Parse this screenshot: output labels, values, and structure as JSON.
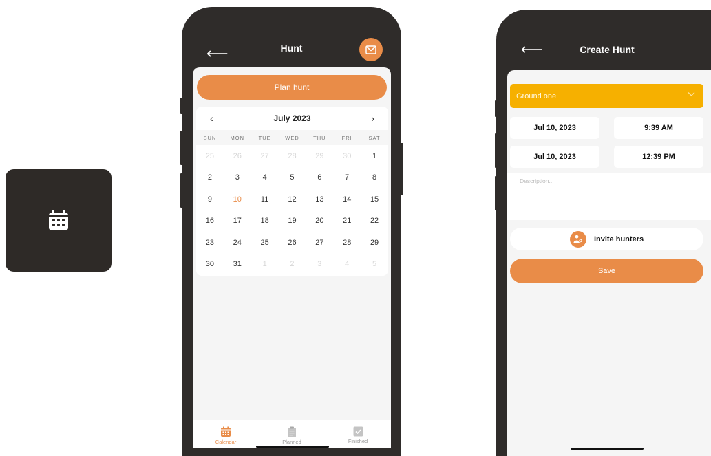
{
  "colors": {
    "accent": "#e98c48",
    "ground": "#f6b000",
    "frame": "#2f2c2a",
    "icon_bg": "#2e2a27"
  },
  "app_icon": {
    "icon": "calendar-icon"
  },
  "hunt_screen": {
    "title": "Hunt",
    "back_icon": "arrow-left-icon",
    "mail_icon": "mail-icon",
    "plan_button": "Plan hunt",
    "calendar": {
      "month": "July 2023",
      "prev": "‹",
      "next": "›",
      "weekdays": [
        "SUN",
        "MON",
        "TUE",
        "WED",
        "THU",
        "FRI",
        "SAT"
      ],
      "days": [
        {
          "d": "25",
          "m": true
        },
        {
          "d": "26",
          "m": true
        },
        {
          "d": "27",
          "m": true
        },
        {
          "d": "28",
          "m": true
        },
        {
          "d": "29",
          "m": true
        },
        {
          "d": "30",
          "m": true
        },
        {
          "d": "1"
        },
        {
          "d": "2"
        },
        {
          "d": "3"
        },
        {
          "d": "4"
        },
        {
          "d": "5"
        },
        {
          "d": "6"
        },
        {
          "d": "7"
        },
        {
          "d": "8"
        },
        {
          "d": "9"
        },
        {
          "d": "10",
          "t": true
        },
        {
          "d": "11"
        },
        {
          "d": "12"
        },
        {
          "d": "13"
        },
        {
          "d": "14"
        },
        {
          "d": "15"
        },
        {
          "d": "16"
        },
        {
          "d": "17"
        },
        {
          "d": "18"
        },
        {
          "d": "19"
        },
        {
          "d": "20"
        },
        {
          "d": "21"
        },
        {
          "d": "22"
        },
        {
          "d": "23"
        },
        {
          "d": "24"
        },
        {
          "d": "25"
        },
        {
          "d": "26"
        },
        {
          "d": "27"
        },
        {
          "d": "28"
        },
        {
          "d": "29"
        },
        {
          "d": "30"
        },
        {
          "d": "31"
        },
        {
          "d": "1",
          "m": true
        },
        {
          "d": "2",
          "m": true
        },
        {
          "d": "3",
          "m": true
        },
        {
          "d": "4",
          "m": true
        },
        {
          "d": "5",
          "m": true
        }
      ]
    },
    "tabs": [
      {
        "label": "Calendar",
        "icon": "calendar-icon",
        "active": true
      },
      {
        "label": "Planned",
        "icon": "clipboard-icon",
        "active": false
      },
      {
        "label": "Finished",
        "icon": "check-square-icon",
        "active": false
      }
    ]
  },
  "create_screen": {
    "title": "Create Hunt",
    "back_icon": "arrow-left-icon",
    "ground_select": "Ground one",
    "start_date": "Jul 10, 2023",
    "start_time": "9:39 AM",
    "end_date": "Jul 10, 2023",
    "end_time": "12:39 PM",
    "description_placeholder": "Description...",
    "invite_button": "Invite hunters",
    "save_button": "Save"
  }
}
